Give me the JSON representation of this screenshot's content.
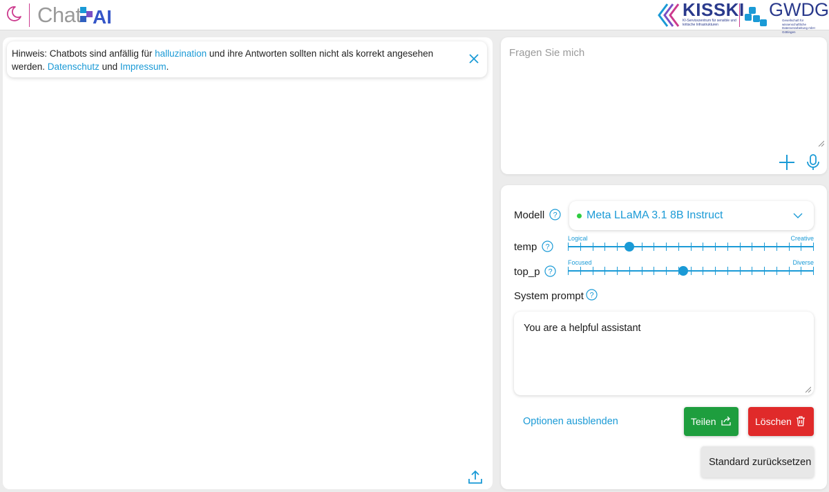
{
  "header": {
    "logo_chat": "Chat",
    "logo_ai": "AI",
    "partner1_name": "KISSKI",
    "partner1_sub": "KI-Servicezentrum für sensible und kritische Infrastrukturen",
    "partner2_name": "GWDG",
    "partner2_sub": "Gesellschaft für wissenschaftliche Datenverarbeitung mbH Göttingen"
  },
  "notice": {
    "prefix": "Hinweis: Chatbots sind anfällig für ",
    "link1": "halluzination",
    "middle": " und ihre Antworten sollten nicht als korrekt angesehen werden. ",
    "link2": "Datenschutz",
    "and": " und ",
    "link3": "Impressum",
    "suffix": "."
  },
  "prompt": {
    "placeholder": "Fragen Sie mich"
  },
  "settings": {
    "model_label": "Modell",
    "model_value": "Meta LLaMA 3.1 8B Instruct",
    "temp_label": "temp",
    "temp_min_label": "Logical",
    "temp_max_label": "Creative",
    "temp_value": 0.25,
    "top_p_label": "top_p",
    "top_p_min_label": "Focused",
    "top_p_max_label": "Diverse",
    "top_p_value": 0.47,
    "system_prompt_label": "System prompt",
    "system_prompt_value": "You are a helpful assistant",
    "options_toggle": "Optionen ausblenden",
    "share_label": "Teilen",
    "delete_label": "Löschen",
    "reset_label": "Standard zurücksetzen"
  },
  "colors": {
    "accent": "#1a9ad6",
    "brand_pink": "#cc3a8e",
    "share": "#1e9e3e",
    "delete": "#e02a2a",
    "model_status": "#2ecc40"
  },
  "icons": [
    "moon-icon",
    "close-icon",
    "upload-icon",
    "plus-icon",
    "microphone-icon",
    "help-icon",
    "chevron-down-icon",
    "share-icon",
    "trash-icon"
  ]
}
